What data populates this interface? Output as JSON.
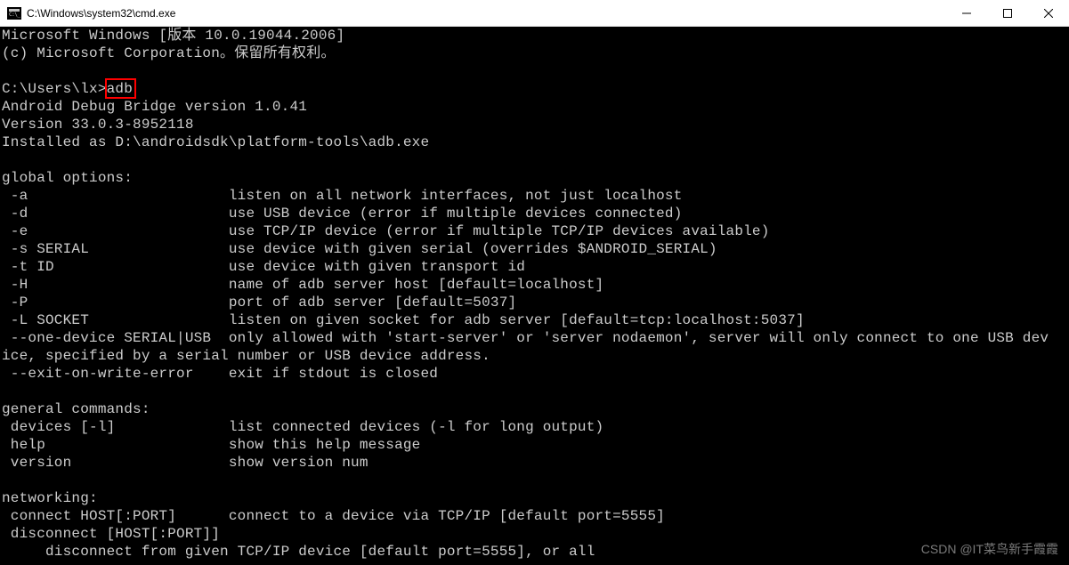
{
  "window": {
    "title": "C:\\Windows\\system32\\cmd.exe",
    "minimize": "minimize",
    "maximize": "maximize",
    "close": "close"
  },
  "highlight": {
    "text": "adb"
  },
  "terminal": {
    "lines": [
      "Microsoft Windows [版本 10.0.19044.2006]",
      "(c) Microsoft Corporation。保留所有权利。",
      "",
      "C:\\Users\\lx>adb",
      "Android Debug Bridge version 1.0.41",
      "Version 33.0.3-8952118",
      "Installed as D:\\androidsdk\\platform-tools\\adb.exe",
      "",
      "global options:",
      " -a                       listen on all network interfaces, not just localhost",
      " -d                       use USB device (error if multiple devices connected)",
      " -e                       use TCP/IP device (error if multiple TCP/IP devices available)",
      " -s SERIAL                use device with given serial (overrides $ANDROID_SERIAL)",
      " -t ID                    use device with given transport id",
      " -H                       name of adb server host [default=localhost]",
      " -P                       port of adb server [default=5037]",
      " -L SOCKET                listen on given socket for adb server [default=tcp:localhost:5037]",
      " --one-device SERIAL|USB  only allowed with 'start-server' or 'server nodaemon', server will only connect to one USB dev",
      "ice, specified by a serial number or USB device address.",
      " --exit-on-write-error    exit if stdout is closed",
      "",
      "general commands:",
      " devices [-l]             list connected devices (-l for long output)",
      " help                     show this help message",
      " version                  show version num",
      "",
      "networking:",
      " connect HOST[:PORT]      connect to a device via TCP/IP [default port=5555]",
      " disconnect [HOST[:PORT]]",
      "     disconnect from given TCP/IP device [default port=5555], or all"
    ]
  },
  "watermark": "CSDN @IT菜鸟新手霞霞"
}
